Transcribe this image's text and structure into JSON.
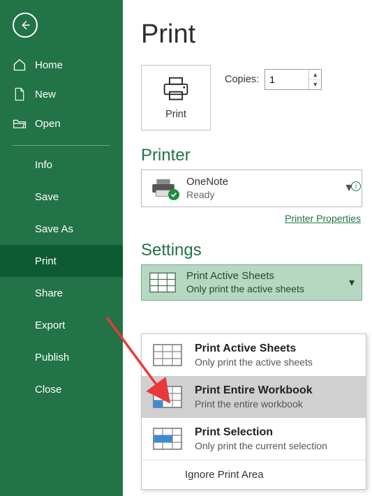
{
  "back": "back",
  "nav_top": [
    {
      "icon": "home-icon",
      "label": "Home"
    },
    {
      "icon": "new-icon",
      "label": "New"
    },
    {
      "icon": "open-icon",
      "label": "Open"
    }
  ],
  "nav_sub": [
    {
      "label": "Info",
      "name": "sidebar-item-info"
    },
    {
      "label": "Save",
      "name": "sidebar-item-save"
    },
    {
      "label": "Save As",
      "name": "sidebar-item-save-as"
    },
    {
      "label": "Print",
      "name": "sidebar-item-print",
      "active": true
    },
    {
      "label": "Share",
      "name": "sidebar-item-share"
    },
    {
      "label": "Export",
      "name": "sidebar-item-export"
    },
    {
      "label": "Publish",
      "name": "sidebar-item-publish"
    },
    {
      "label": "Close",
      "name": "sidebar-item-close"
    }
  ],
  "page": {
    "title": "Print",
    "print_button_label": "Print",
    "copies_label": "Copies:",
    "copies_value": "1"
  },
  "printer": {
    "section_title": "Printer",
    "name": "OneNote",
    "status": "Ready",
    "properties_link": "Printer Properties"
  },
  "settings": {
    "section_title": "Settings",
    "selected_title": "Print Active Sheets",
    "selected_subtitle": "Only print the active sheets"
  },
  "dropdown": {
    "items": [
      {
        "title": "Print Active Sheets",
        "subtitle": "Only print the active sheets",
        "hovered": false,
        "accent": "none"
      },
      {
        "title": "Print Entire Workbook",
        "subtitle": "Print the entire workbook",
        "hovered": true,
        "accent": "blue"
      },
      {
        "title": "Print Selection",
        "subtitle": "Only print the current selection",
        "hovered": false,
        "accent": "blue"
      }
    ],
    "ignore_label": "Ignore Print Area"
  },
  "annotation_color": "#e83a3a"
}
